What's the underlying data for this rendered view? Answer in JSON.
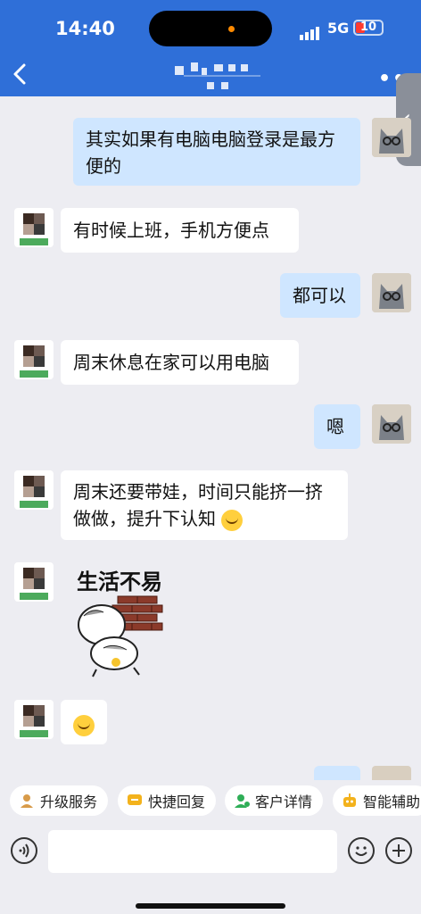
{
  "status": {
    "time": "14:40",
    "network": "5G",
    "battery": "10"
  },
  "header": {
    "more": "•••"
  },
  "messages": [
    {
      "side": "right",
      "text": "其实如果有电脑电脑登录是最方便的"
    },
    {
      "side": "left",
      "text": "有时候上班，手机方便点"
    },
    {
      "side": "right",
      "text": "都可以"
    },
    {
      "side": "left",
      "text": "周末休息在家可以用电脑"
    },
    {
      "side": "right",
      "text": "嗯"
    },
    {
      "side": "left",
      "text": "周末还要带娃，时间只能挤一挤做做，提升下认知"
    },
    {
      "side": "left",
      "type": "sticker",
      "text": "生活不易"
    },
    {
      "side": "left",
      "type": "emoji",
      "text": ""
    }
  ],
  "quick_actions": [
    {
      "label": "升级服务",
      "icon": "person-icon"
    },
    {
      "label": "快捷回复",
      "icon": "reply-icon"
    },
    {
      "label": "客户详情",
      "icon": "customer-icon"
    },
    {
      "label": "智能辅助",
      "icon": "robot-icon"
    }
  ],
  "input": {
    "placeholder": ""
  },
  "colors": {
    "header": "#2f6fd8",
    "bubble_right": "#cfe6ff",
    "bubble_left": "#ffffff",
    "background": "#ededf2"
  }
}
